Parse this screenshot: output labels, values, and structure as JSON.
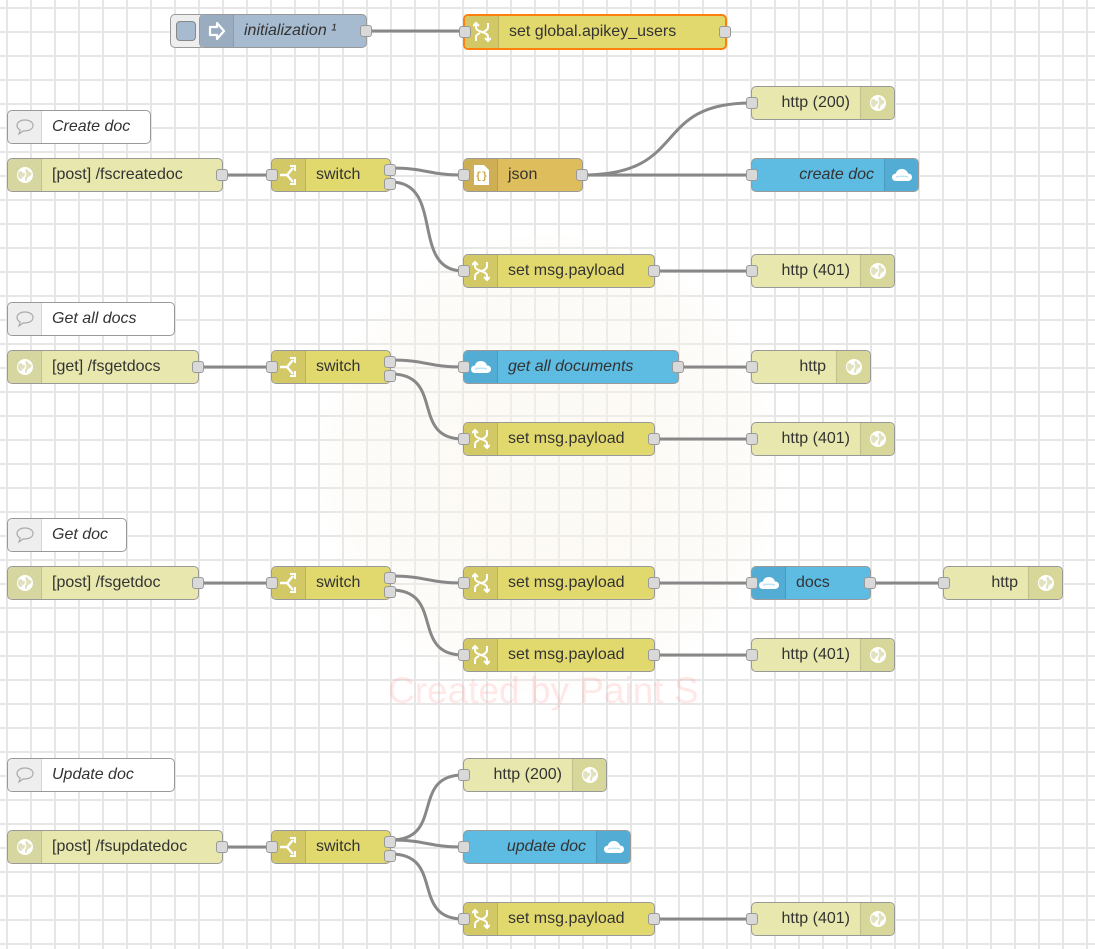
{
  "flows": [
    {
      "comment": "",
      "nodes": [
        {
          "id": "init",
          "type": "inject",
          "label": "initialization ¹"
        },
        {
          "id": "setglobal",
          "type": "change",
          "label": "set global.apikey_users",
          "selected": true
        }
      ]
    },
    {
      "comment": "Create doc",
      "nodes": [
        {
          "id": "c_in",
          "type": "http-in",
          "label": "[post] /fscreatedoc"
        },
        {
          "id": "c_sw",
          "type": "switch",
          "label": "switch"
        },
        {
          "id": "c_json",
          "type": "json",
          "label": "json"
        },
        {
          "id": "c_200",
          "type": "http-response",
          "label": "http (200)"
        },
        {
          "id": "c_doc",
          "type": "firestore",
          "label": "create doc"
        },
        {
          "id": "c_set",
          "type": "change",
          "label": "set msg.payload"
        },
        {
          "id": "c_401",
          "type": "http-response",
          "label": "http (401)"
        }
      ]
    },
    {
      "comment": "Get all docs",
      "nodes": [
        {
          "id": "ga_in",
          "type": "http-in",
          "label": "[get] /fsgetdocs"
        },
        {
          "id": "ga_sw",
          "type": "switch",
          "label": "switch"
        },
        {
          "id": "ga_get",
          "type": "firestore",
          "label": "get all documents"
        },
        {
          "id": "ga_http",
          "type": "http-response",
          "label": "http"
        },
        {
          "id": "ga_set",
          "type": "change",
          "label": "set msg.payload"
        },
        {
          "id": "ga_401",
          "type": "http-response",
          "label": "http (401)"
        }
      ]
    },
    {
      "comment": "Get doc",
      "nodes": [
        {
          "id": "g_in",
          "type": "http-in",
          "label": "[post] /fsgetdoc"
        },
        {
          "id": "g_sw",
          "type": "switch",
          "label": "switch"
        },
        {
          "id": "g_set1",
          "type": "change",
          "label": "set msg.payload"
        },
        {
          "id": "g_docs",
          "type": "firestore",
          "label": "docs"
        },
        {
          "id": "g_http",
          "type": "http-response",
          "label": "http"
        },
        {
          "id": "g_set2",
          "type": "change",
          "label": "set msg.payload"
        },
        {
          "id": "g_401",
          "type": "http-response",
          "label": "http (401)"
        }
      ]
    },
    {
      "comment": "Update doc",
      "nodes": [
        {
          "id": "u_in",
          "type": "http-in",
          "label": "[post] /fsupdatedoc"
        },
        {
          "id": "u_sw",
          "type": "switch",
          "label": "switch"
        },
        {
          "id": "u_200",
          "type": "http-response",
          "label": "http (200)"
        },
        {
          "id": "u_doc",
          "type": "firestore",
          "label": "update doc"
        },
        {
          "id": "u_set",
          "type": "change",
          "label": "set msg.payload"
        },
        {
          "id": "u_401",
          "type": "http-response",
          "label": "http (401)"
        }
      ]
    }
  ],
  "watermark": "Created by Paint S",
  "colors": {
    "http": "#e7e7ae",
    "change": "#e2d96e",
    "json": "#debd5c",
    "firestore": "#5ebbe2",
    "inject": "#a6bbcf",
    "selected_border": "#ff7f0e",
    "wire": "#888888"
  }
}
